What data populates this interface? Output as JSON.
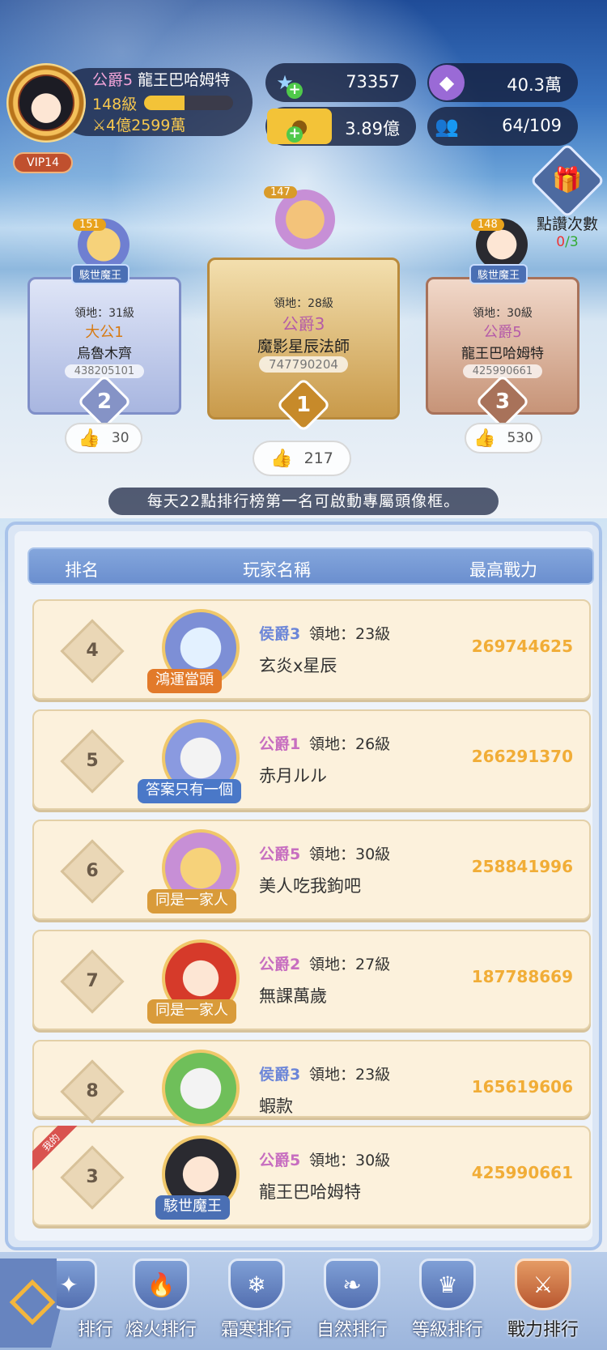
{
  "profile": {
    "rank_title": "公爵5",
    "name": "龍王巴哈姆特",
    "level": "148級",
    "exp_fraction": 0.45,
    "power": "4億2599萬",
    "vip": "VIP14"
  },
  "resources": {
    "crystal": "73357",
    "gem": "40.3萬",
    "gold": "3.89億",
    "members": "64/109"
  },
  "likes_panel": {
    "label": "點讚次數",
    "used": "0",
    "sep": "/",
    "total": "3"
  },
  "podium": {
    "first": {
      "level": "147",
      "territory": "領地：28級",
      "rank_title": "公爵3",
      "name": "魔影星辰法師",
      "power": "747790204",
      "position": "1",
      "likes": "217"
    },
    "second": {
      "level": "151",
      "badge": "駭世魔王",
      "territory": "領地：31級",
      "rank_title": "大公1",
      "name": "烏魯木齊",
      "power": "438205101",
      "position": "2",
      "likes": "30"
    },
    "third": {
      "level": "148",
      "badge": "駭世魔王",
      "territory": "領地：30級",
      "rank_title": "公爵5",
      "name": "龍王巴哈姆特",
      "power": "425990661",
      "position": "3",
      "likes": "530"
    }
  },
  "banner": "每天22點排行榜第一名可啟動專屬頭像框。",
  "table": {
    "headers": {
      "rank": "排名",
      "name": "玩家名稱",
      "power": "最高戰力"
    },
    "rows": [
      {
        "rank": "4",
        "frame": "鴻運當頭",
        "rank_title": "侯爵3",
        "territory": "領地：23級",
        "name": "玄炎x星辰",
        "power": "269744625"
      },
      {
        "rank": "5",
        "frame": "答案只有一個",
        "rank_title": "公爵1",
        "territory": "領地：26級",
        "name": "赤月ルル",
        "power": "266291370"
      },
      {
        "rank": "6",
        "frame": "同是一家人",
        "rank_title": "公爵5",
        "territory": "領地：30級",
        "name": "美人吃我鉤吧",
        "power": "258841996"
      },
      {
        "rank": "7",
        "frame": "同是一家人",
        "rank_title": "公爵2",
        "territory": "領地：27級",
        "name": "無課萬歲",
        "power": "187788669"
      },
      {
        "rank": "8",
        "frame": "",
        "rank_title": "侯爵3",
        "territory": "領地：23級",
        "name": "蝦款",
        "power": "165619606"
      }
    ],
    "mine": {
      "tag": "我的",
      "rank": "3",
      "frame": "駭世魔王",
      "rank_title": "公爵5",
      "territory": "領地：30級",
      "name": "龍王巴哈姆特",
      "power": "425990661"
    }
  },
  "nav": {
    "items": [
      {
        "label": "排行"
      },
      {
        "label": "熔火排行"
      },
      {
        "label": "霜寒排行"
      },
      {
        "label": "自然排行"
      },
      {
        "label": "等級排行"
      },
      {
        "label": "戰力排行"
      }
    ],
    "active": "戰力排行"
  },
  "colors": {
    "marquis": "#6c86d8",
    "duke": "#c76ec0",
    "archduke": "#e08a1c",
    "power_text": "#f1ad37"
  }
}
